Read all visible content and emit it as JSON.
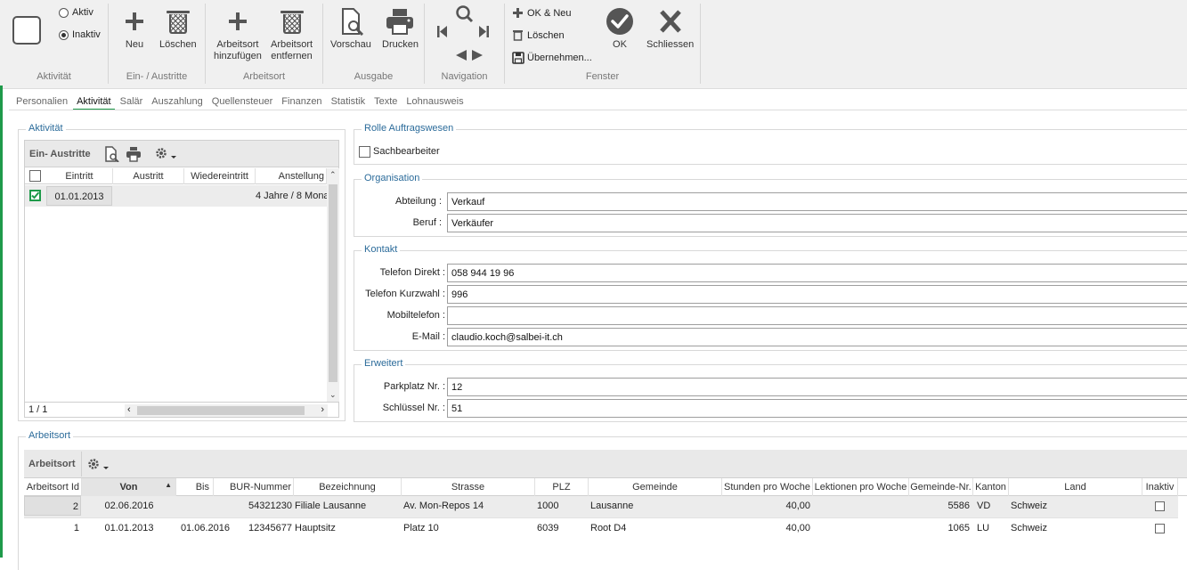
{
  "ribbon": {
    "aktivitaet": {
      "aktiv": "Aktiv",
      "inaktiv": "Inaktiv",
      "group": "Aktivität"
    },
    "ein_austritte": {
      "neu": "Neu",
      "loeschen": "Löschen",
      "group": "Ein- / Austritte"
    },
    "arbeitsort": {
      "hinzufuegen_1": "Arbeitsort",
      "hinzufuegen_2": "hinzufügen",
      "entfernen_1": "Arbeitsort",
      "entfernen_2": "entfernen",
      "group": "Arbeitsort"
    },
    "ausgabe": {
      "vorschau": "Vorschau",
      "drucken": "Drucken",
      "group": "Ausgabe"
    },
    "navigation": {
      "group": "Navigation"
    },
    "fenster": {
      "ok_neu": "OK & Neu",
      "loeschen": "Löschen",
      "uebernehmen": "Übernehmen...",
      "ok": "OK",
      "schliessen": "Schliessen",
      "group": "Fenster"
    }
  },
  "tabs": [
    "Personalien",
    "Aktivität",
    "Salär",
    "Auszahlung",
    "Quellensteuer",
    "Finanzen",
    "Statistik",
    "Texte",
    "Lohnausweis"
  ],
  "aktivitaet_panel": {
    "legend": "Aktivität",
    "grid_title": "Ein- Austritte",
    "columns": [
      "Eintritt",
      "Austritt",
      "Wiedereintritt",
      "Anstellung"
    ],
    "row": {
      "eintritt": "01.01.2013",
      "austritt": "",
      "wiedereintritt": "",
      "anstellung": "4 Jahre / 8 Mona"
    },
    "pager": "1 / 1"
  },
  "rolle": {
    "legend": "Rolle Auftragswesen",
    "sachbearbeiter": "Sachbearbeiter"
  },
  "organisation": {
    "legend": "Organisation",
    "abteilung_label": "Abteilung :",
    "abteilung": "Verkauf",
    "beruf_label": "Beruf :",
    "beruf": "Verkäufer"
  },
  "kontakt": {
    "legend": "Kontakt",
    "telefon_direkt_label": "Telefon Direkt :",
    "telefon_direkt": "058 944 19 96",
    "telefon_kurzwahl_label": "Telefon Kurzwahl :",
    "telefon_kurzwahl": "996",
    "mobiltelefon_label": "Mobiltelefon :",
    "mobiltelefon": "",
    "email_label": "E-Mail :",
    "email": "claudio.koch@salbei-it.ch"
  },
  "erweitert": {
    "legend": "Erweitert",
    "parkplatz_label": "Parkplatz Nr. :",
    "parkplatz": "12",
    "schluessel_label": "Schlüssel Nr. :",
    "schluessel": "51"
  },
  "arbeitsort_panel": {
    "legend": "Arbeitsort",
    "grid_title": "Arbeitsort",
    "columns": [
      "Arbeitsort Id",
      "Von",
      "Bis",
      "BUR-Nummer",
      "Bezeichnung",
      "Strasse",
      "PLZ",
      "Gemeinde",
      "Stunden pro Woche",
      "Lektionen pro Woche",
      "Gemeinde-Nr.",
      "Kanton",
      "Land",
      "Inaktiv"
    ],
    "rows": [
      [
        "2",
        "02.06.2016",
        "",
        "54321230",
        "Filiale Lausanne",
        "Av. Mon-Repos 14",
        "1000",
        "Lausanne",
        "40,00",
        "",
        "5586",
        "VD",
        "Schweiz",
        ""
      ],
      [
        "1",
        "01.01.2013",
        "01.06.2016",
        "12345677",
        "Hauptsitz",
        "Platz 10",
        "6039",
        "Root D4",
        "40,00",
        "",
        "1065",
        "LU",
        "Schweiz",
        ""
      ]
    ]
  }
}
